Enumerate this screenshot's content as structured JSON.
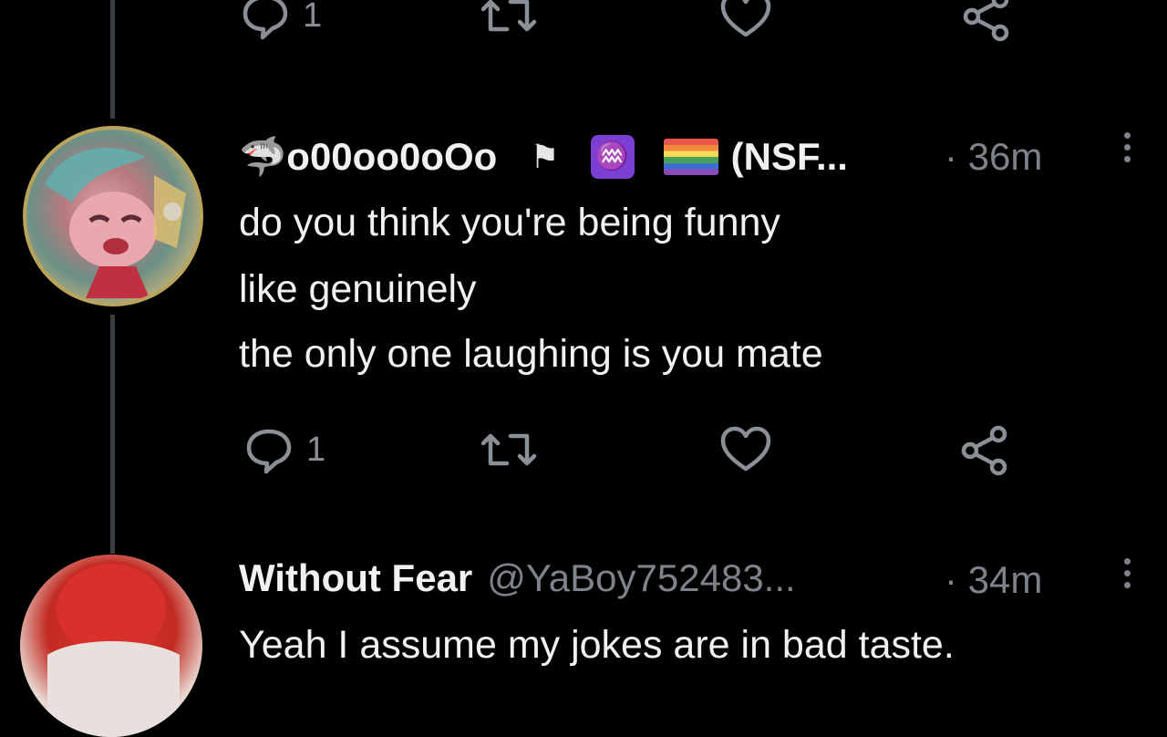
{
  "top_actions": {
    "reply_count": "1"
  },
  "post1": {
    "display_name": "🦈o00oo0oOo",
    "badges": [
      "⚑",
      "♒",
      "🏳️‍🌈"
    ],
    "name_suffix": "(NSF...",
    "time": "· 36m",
    "lines": [
      "do you think you're being funny",
      "like genuinely",
      "the only one laughing is you mate"
    ],
    "reply_count": "1"
  },
  "post2": {
    "display_name": "Without Fear",
    "handle": "@YaBoy752483...",
    "time": "· 34m",
    "line": "Yeah I assume my jokes are in bad taste."
  },
  "colors": {
    "background": "#000000",
    "text": "#f1f1f1",
    "muted": "#7d8389",
    "badge_purple": "#7b3fd1"
  },
  "icons": [
    "reply-icon",
    "repost-icon",
    "like-icon",
    "share-icon",
    "more-icon"
  ]
}
